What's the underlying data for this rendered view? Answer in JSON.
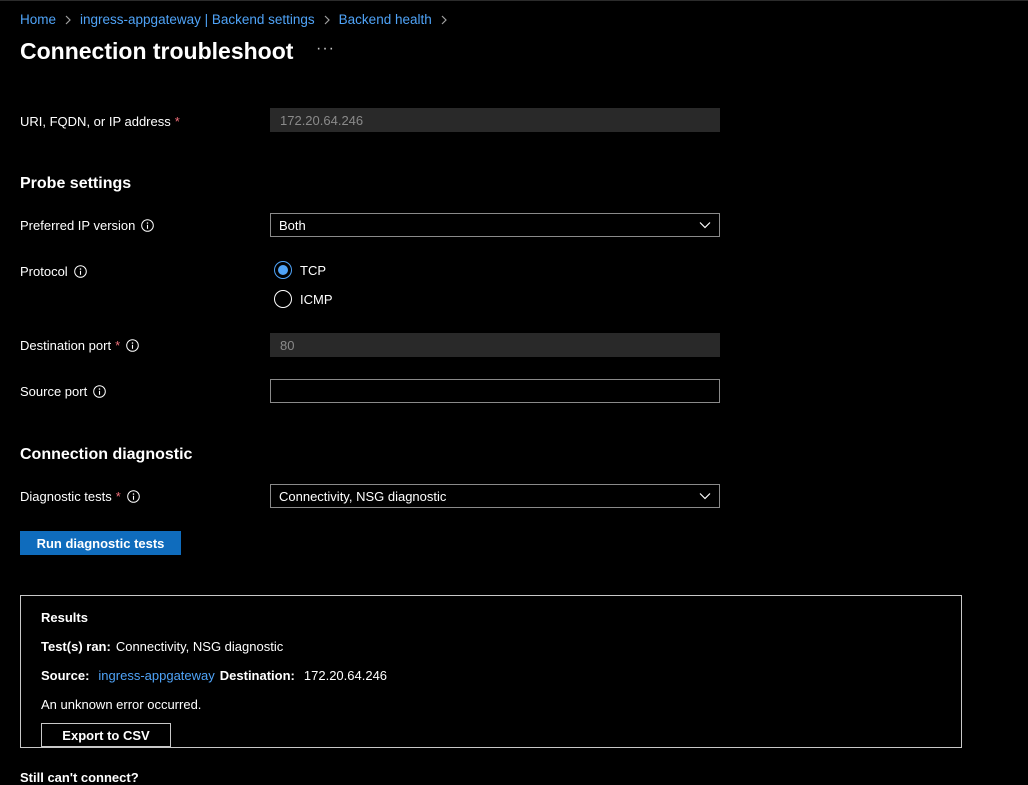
{
  "breadcrumb": {
    "items": [
      "Home",
      "ingress-appgateway | Backend settings",
      "Backend health"
    ]
  },
  "page": {
    "title": "Connection troubleshoot",
    "more_label": "···"
  },
  "target": {
    "label": "URI, FQDN, or IP address",
    "required_mark": "*",
    "value": "172.20.64.246"
  },
  "probe_settings": {
    "title": "Probe settings",
    "ip_version": {
      "label": "Preferred IP version",
      "value": "Both"
    },
    "protocol": {
      "label": "Protocol",
      "options": [
        "TCP",
        "ICMP"
      ],
      "selected": "TCP"
    },
    "destination_port": {
      "label": "Destination port",
      "required_mark": "*",
      "value": "80"
    },
    "source_port": {
      "label": "Source port",
      "value": ""
    }
  },
  "connection_diagnostic": {
    "title": "Connection diagnostic",
    "tests": {
      "label": "Diagnostic tests",
      "required_mark": "*",
      "value": "Connectivity, NSG diagnostic"
    },
    "run_button": "Run diagnostic tests"
  },
  "results": {
    "title": "Results",
    "tests_ran_label": "Test(s) ran:",
    "tests_ran_value": "Connectivity, NSG diagnostic",
    "source_label": "Source:",
    "source_value": "ingress-appgateway",
    "destination_label": "Destination:",
    "destination_value": "172.20.64.246",
    "message": "An unknown error occurred.",
    "export_button": "Export to CSV"
  },
  "footer": {
    "still_cant_connect": "Still can't connect?"
  },
  "colors": {
    "background": "#000000",
    "link": "#4fa3f7",
    "primary": "#0f6cbd",
    "required": "#f1707b",
    "disabled_input": "#292929"
  },
  "icons": {
    "breadcrumb_separator": "chevron-right-icon",
    "info": "info-icon",
    "dropdown": "chevron-down-icon",
    "more": "more-icon"
  }
}
